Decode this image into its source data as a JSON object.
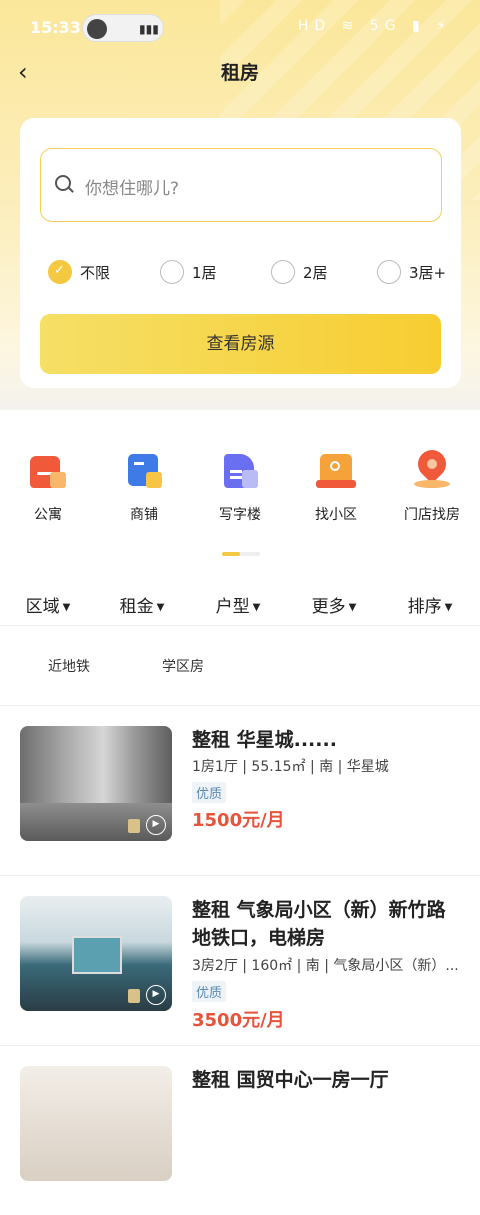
{
  "status_bar": {
    "time": "15:33",
    "icons": "HD ≋ 5G ▮ ⚡"
  },
  "header": {
    "title": "租房"
  },
  "search": {
    "placeholder": "你想住哪儿?",
    "room_options": [
      {
        "label": "不限",
        "checked": true
      },
      {
        "label": "1居",
        "checked": false
      },
      {
        "label": "2居",
        "checked": false
      },
      {
        "label": "3居+",
        "checked": false
      }
    ],
    "view_button": "查看房源"
  },
  "categories": [
    {
      "label": "公寓",
      "icon": "apartment-icon"
    },
    {
      "label": "商铺",
      "icon": "shop-icon"
    },
    {
      "label": "写字楼",
      "icon": "office-icon"
    },
    {
      "label": "找小区",
      "icon": "community-search-icon"
    },
    {
      "label": "门店找房",
      "icon": "store-location-icon"
    }
  ],
  "filters": [
    "区域",
    "租金",
    "户型",
    "更多",
    "排序"
  ],
  "quick_tags": [
    "近地铁",
    "学区房"
  ],
  "listings": [
    {
      "title": "整租 华星城......",
      "meta": "1房1厅 | 55.15㎡ | 南 | 华星城",
      "tag": "优质",
      "price": "1500元/月"
    },
    {
      "title": "整租 气象局小区（新）新竹路地铁口，电梯房",
      "meta": "3房2厅 | 160㎡ | 南 | 气象局小区（新）...",
      "tag": "优质",
      "price": "3500元/月"
    },
    {
      "title": "整租 国贸中心一房一厅"
    }
  ],
  "colors": {
    "accent": "#f5c842",
    "price": "#e8533c",
    "tag": "#5a89b5"
  }
}
